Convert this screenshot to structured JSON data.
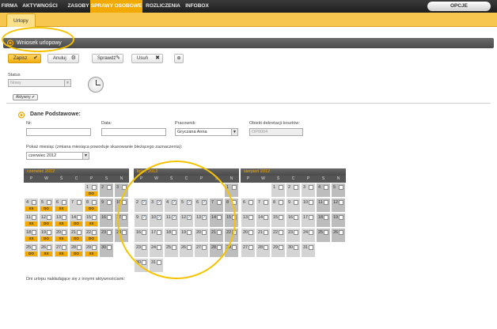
{
  "nav": {
    "items": [
      "FIRMA",
      "AKTYWNOŚCI",
      "ZASOBY",
      "SPRAWY OSOBOWE",
      "ROZLICZENIA",
      "INFOBOX"
    ],
    "active_index": 3,
    "options_label": "OPCJE"
  },
  "subnav": {
    "tab": "Urlopy"
  },
  "form": {
    "title": "Wniosek urlopowy"
  },
  "toolbar": {
    "save": "Zapisz",
    "cancel": "Anuluj",
    "check": "Sprawdź",
    "delete": "Usuń"
  },
  "status": {
    "label": "Status",
    "value": "Nowy",
    "active_button": "Aktywny"
  },
  "section": {
    "title": "Dane Podstawowe:",
    "nr_label": "Nr:",
    "data_label": "Data:",
    "employee_label": "Pracownik:",
    "employee_value": "Gryczana Anna",
    "cost_label": "Obiekt dekretacji kosztów:",
    "cost_value": "OP0004",
    "month_label": "Pokaż miesiąc (zmiana miesiąca powoduje skasowanie bieżącego zaznaczenia):",
    "month_value": "czerwiec 2012"
  },
  "weekdays": [
    "P",
    "W",
    "Ś",
    "C",
    "P",
    "S",
    "N"
  ],
  "calendars": [
    {
      "title": "czerwiec 2012",
      "offset": 4,
      "days": 30,
      "checked": [],
      "tags": {
        "1": "DO",
        "4": "XX",
        "5": "DO",
        "6": "XX",
        "8": "DO",
        "11": "XX",
        "12": "DO",
        "13": "XX",
        "14": "DO",
        "15": "XX",
        "18": "XX",
        "19": "DO",
        "20": "XX",
        "21": "DO",
        "22": "DO",
        "25": "DO",
        "26": "XX",
        "27": "XX",
        "28": "DO",
        "29": "XX"
      }
    },
    {
      "title": "lipiec 2012",
      "offset": 6,
      "days": 31,
      "checked": [
        2,
        3,
        4,
        5,
        6,
        9,
        10,
        11,
        12,
        13
      ],
      "tags": {}
    },
    {
      "title": "sierpień 2012",
      "offset": 2,
      "days": 31,
      "checked": [],
      "tags": {}
    }
  ],
  "footnote": "Dni urlopu nakładające się z innymi aktywnościami:"
}
